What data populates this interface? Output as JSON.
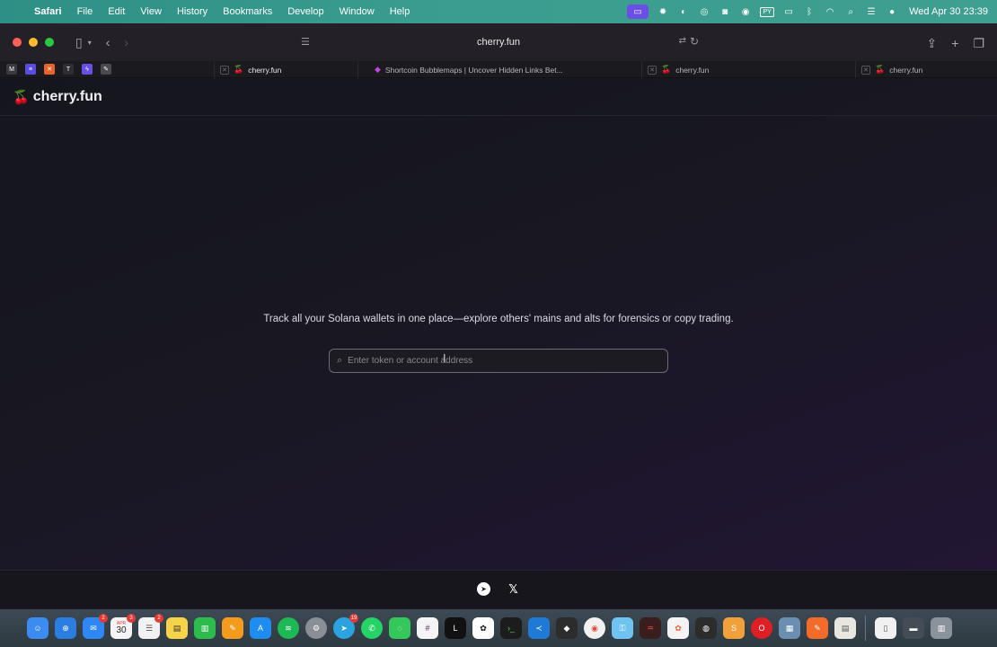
{
  "menubar": {
    "app": "Safari",
    "items": [
      "File",
      "Edit",
      "View",
      "History",
      "Bookmarks",
      "Develop",
      "Window",
      "Help"
    ],
    "clock": "Wed Apr 30  23:39"
  },
  "toolbar": {
    "url": "cherry.fun"
  },
  "tabs": [
    {
      "title": "cherry.fun",
      "active": true
    },
    {
      "title": "Shortcoin Bubblemaps | Uncover Hidden Links Bet...",
      "active": false
    },
    {
      "title": "cherry.fun",
      "active": false
    },
    {
      "title": "cherry.fun",
      "active": false
    }
  ],
  "site": {
    "brand": "cherry.fun",
    "tagline": "Track all your Solana wallets in one place—explore others' mains and alts for forensics or copy trading.",
    "search_placeholder": "Enter token or account address"
  },
  "dock": {
    "calendar_month": "APR",
    "calendar_day": "30",
    "badges": {
      "mail": "2",
      "calendar": "3",
      "reminders": "2",
      "telegram": "19"
    }
  },
  "colors": {
    "menubar": "#3a9d8f",
    "page_bg": "#181722",
    "accent_purple": "#6b4ee6"
  }
}
